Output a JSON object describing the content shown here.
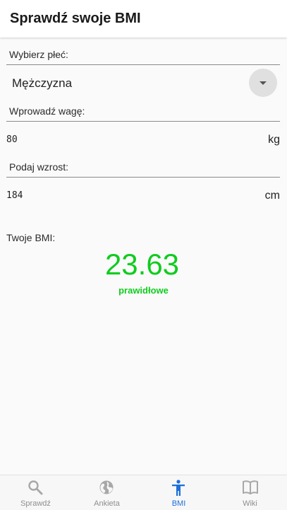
{
  "app_bar": {
    "title": "Sprawdź swoje BMI"
  },
  "form": {
    "gender_label": "Wybierz płeć:",
    "gender_value": "Mężczyzna",
    "weight_label": "Wprowadź wagę:",
    "weight_value": "80",
    "weight_unit": "kg",
    "height_label": "Podaj wzrost:",
    "height_value": "184",
    "height_unit": "cm"
  },
  "result": {
    "caption": "Twoje BMI:",
    "value": "23.63",
    "category": "prawidłowe",
    "color": "#0fcc1e"
  },
  "tabs": [
    {
      "label": "Sprawdź",
      "icon": "search-icon",
      "active": false
    },
    {
      "label": "Ankieta",
      "icon": "globe-icon",
      "active": false
    },
    {
      "label": "BMI",
      "icon": "accessibility-icon",
      "active": true
    },
    {
      "label": "Wiki",
      "icon": "book-icon",
      "active": false
    }
  ],
  "colors": {
    "accent": "#1e6fd9",
    "inactive_tab": "#8e8e8e",
    "result_green": "#0fcc1e"
  }
}
